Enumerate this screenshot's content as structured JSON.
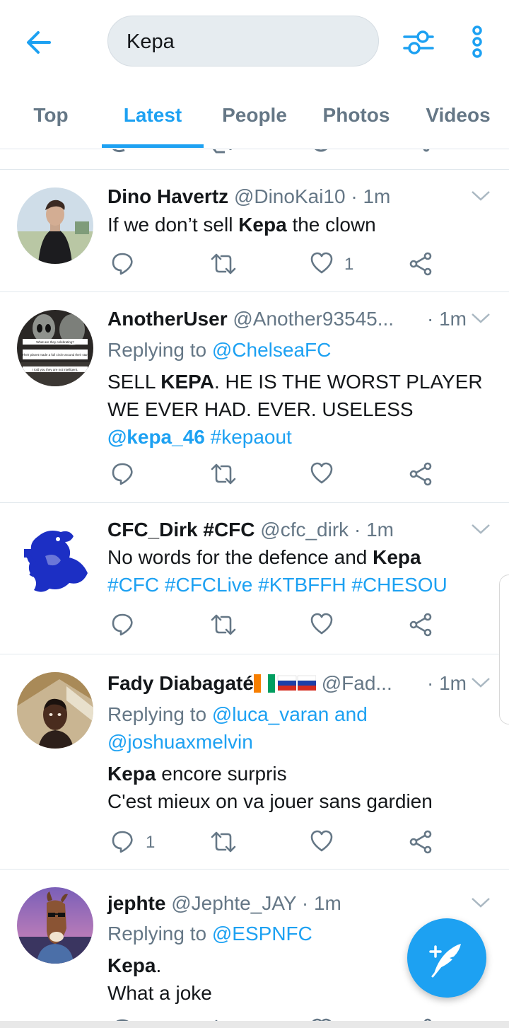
{
  "search": {
    "query": "Kepa"
  },
  "tabs": [
    {
      "label": "Top"
    },
    {
      "label": "Latest"
    },
    {
      "label": "People"
    },
    {
      "label": "Photos"
    },
    {
      "label": "Videos"
    }
  ],
  "colors": {
    "accent": "#1da1f2",
    "muted": "#657786",
    "text": "#14171a",
    "divider": "#e1e8ed"
  },
  "tweets": [
    {
      "name": "Dino Havertz",
      "handle": "@DinoKai10",
      "sep": "·",
      "time": "1m",
      "body_pre": "If we don’t sell ",
      "body_bold": "Kepa",
      "body_post": " the clown",
      "like_count": "1"
    },
    {
      "name": "AnotherUser",
      "handle": "@Another93545...",
      "sep": "·",
      "time": "1m",
      "replying_prefix": "Replying to ",
      "replying_to": "@ChelseaFC",
      "avatar_texts": [
        "What are they celebrating?",
        "Their planet made a full circle around their star.",
        "I told you they are not intelligent."
      ],
      "line1_pre": "SELL ",
      "line1_bold": "KEPA",
      "line1_post": ". HE IS THE WORST PLAYER",
      "line2": "WE EVER HAD. EVER. USELESS",
      "mention": "@kepa_46",
      "hashtag": "#kepaout"
    },
    {
      "name": "CFC_Dirk #CFC",
      "handle": "@cfc_dirk",
      "sep": "·",
      "time": "1m",
      "body_pre": "No words for the defence and ",
      "body_bold": "Kepa",
      "hashtags": "#CFC #CFCLive #KTBFFH #CHESOU"
    },
    {
      "name": "Fady Diabagaté",
      "handle": "@Fad...",
      "sep": "·",
      "time": "1m",
      "replying_prefix": "Replying to ",
      "replying_to_1": "@luca_varan",
      "replying_and": " and",
      "replying_to_2": "@joshuaxmelvin",
      "line1_bold": "Kepa",
      "line1_post": " encore surpris",
      "line2": "C'est mieux on va jouer sans gardien",
      "reply_count": "1"
    },
    {
      "name": "jephte",
      "handle": "@Jephte_JAY",
      "sep": "·",
      "time": "1m",
      "replying_prefix": "Replying to ",
      "replying_to": "@ESPNFC",
      "line1_bold": "Kepa",
      "line1_post": ".",
      "line2": "What a joke"
    }
  ],
  "icons": {
    "back": "arrow-left-icon",
    "filter": "filter-sliders-icon",
    "more": "more-vertical-icon",
    "reply": "reply-bubble-icon",
    "retweet": "retweet-icon",
    "like": "heart-icon",
    "share": "share-icon",
    "compose": "compose-feather-icon"
  }
}
